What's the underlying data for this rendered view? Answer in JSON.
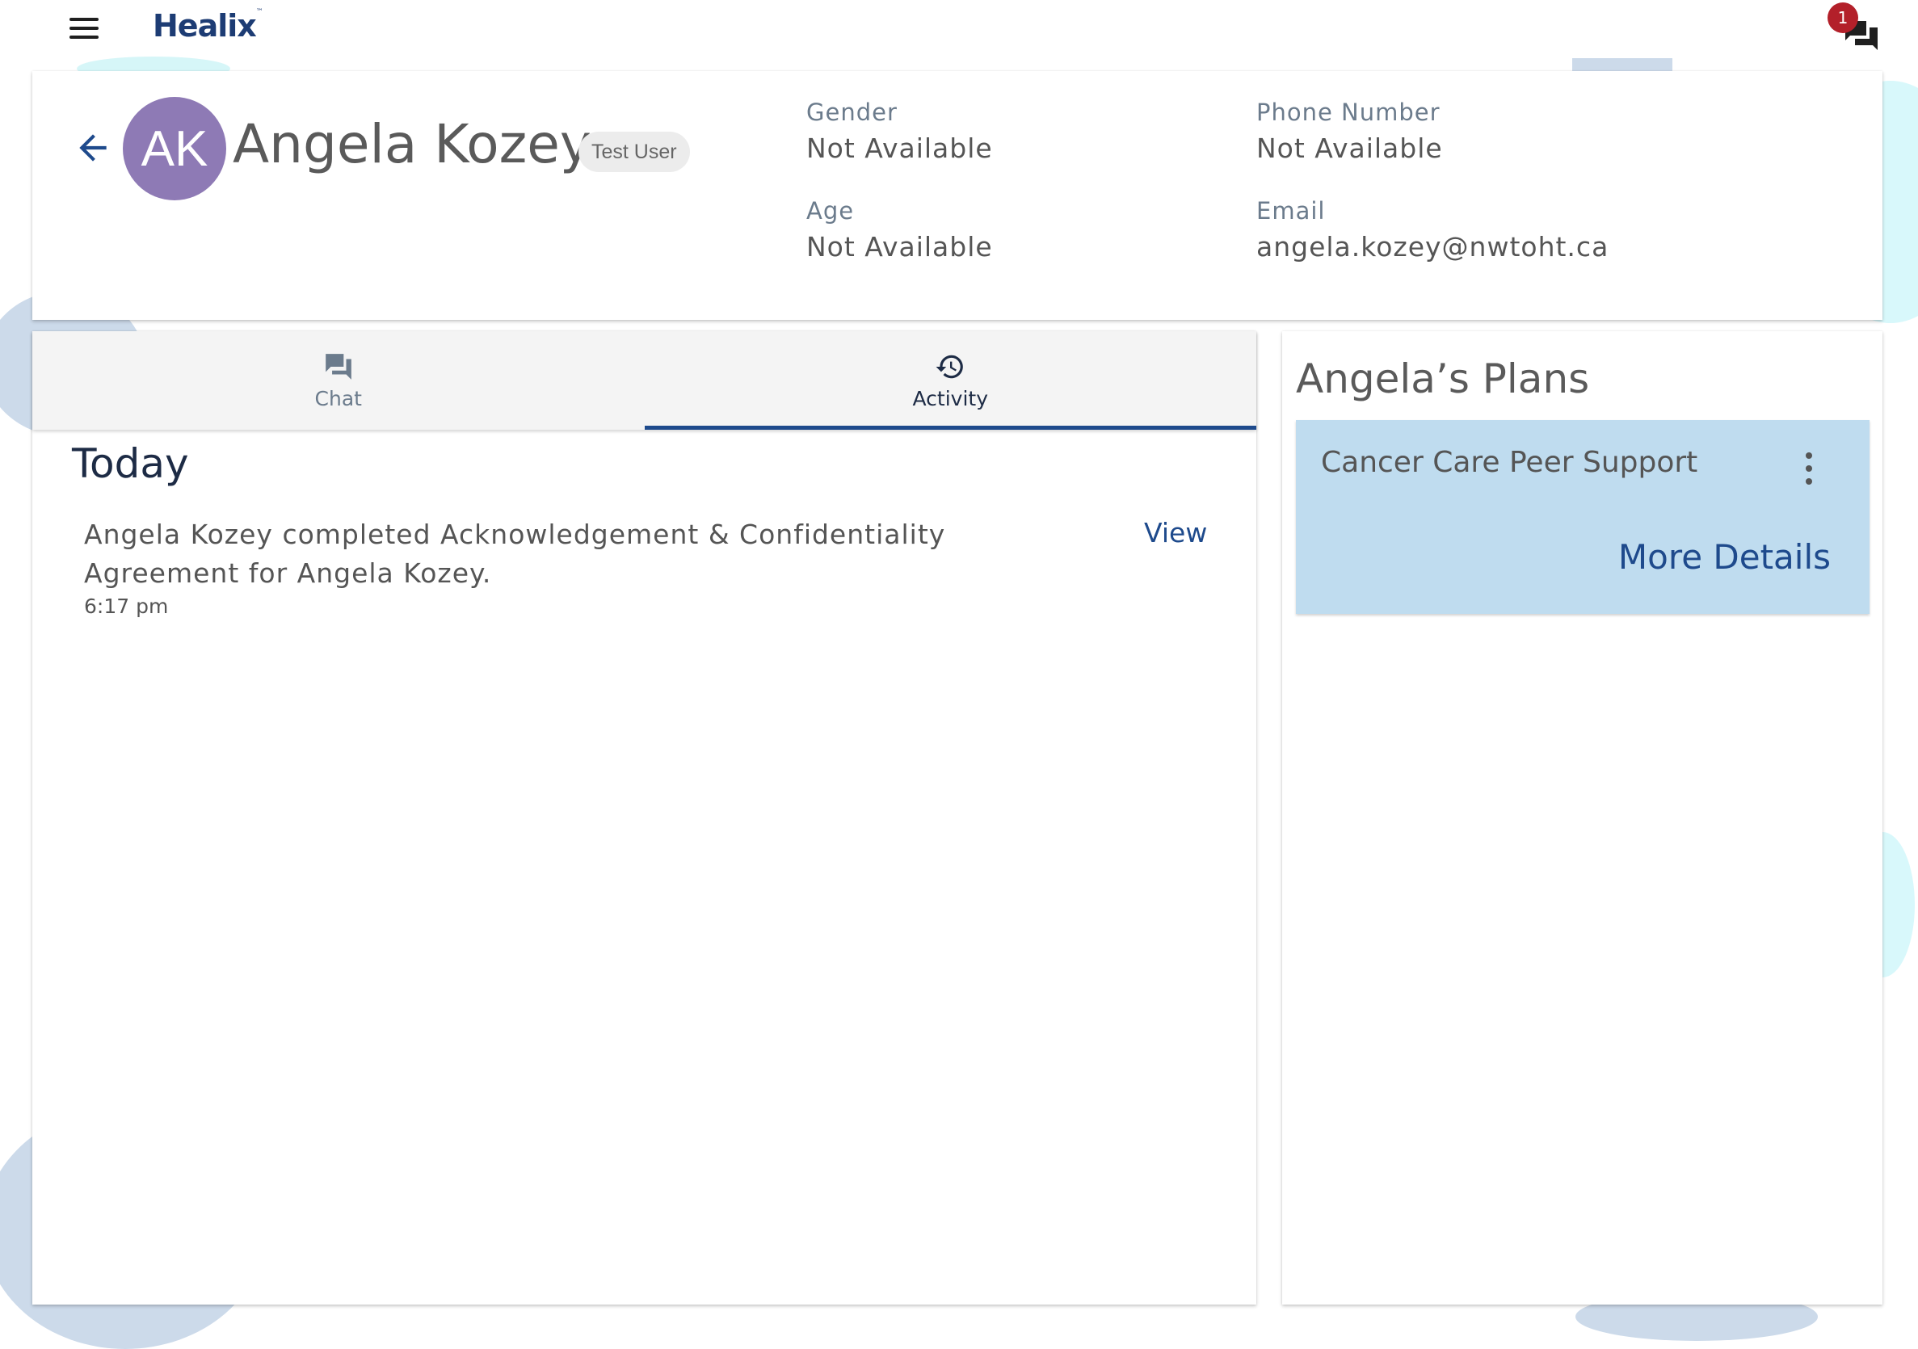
{
  "app": {
    "logo_text": "Healix",
    "logo_tm": "™",
    "notification_count": "1"
  },
  "profile": {
    "initials": "AK",
    "name": "Angela Kozey",
    "chip": "Test User",
    "fields": {
      "gender_label": "Gender",
      "gender_value": "Not Available",
      "age_label": "Age",
      "age_value": "Not Available",
      "phone_label": "Phone Number",
      "phone_value": "Not Available",
      "email_label": "Email",
      "email_value": "angela.kozey@nwtoht.ca"
    }
  },
  "tabs": [
    {
      "label": "Chat",
      "icon": "chat-icon",
      "active": false
    },
    {
      "label": "Activity",
      "icon": "history-icon",
      "active": true
    }
  ],
  "activity": {
    "section_title": "Today",
    "items": [
      {
        "text": "Angela Kozey completed Acknowledgement & Confidentiality Agreement for Angela Kozey.",
        "time": "6:17 pm",
        "action": "View"
      }
    ]
  },
  "plans": {
    "title": "Angela’s Plans",
    "items": [
      {
        "name": "Cancer Care Peer Support",
        "action": "More Details"
      }
    ]
  },
  "colors": {
    "brand": "#1d3c74",
    "accent": "#1e4a8c",
    "avatar": "#8e7ab5",
    "plan_card": "#bfdcef",
    "badge": "#b3202a"
  }
}
